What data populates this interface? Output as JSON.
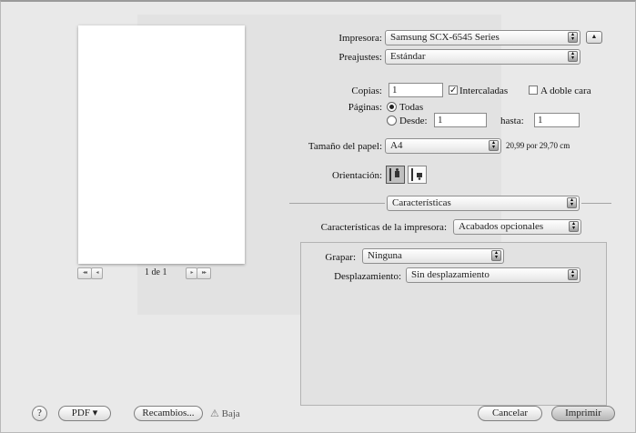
{
  "printer": {
    "label": "Impresora:",
    "value": "Samsung SCX-6545 Series"
  },
  "presets": {
    "label": "Preajustes:",
    "value": "Estándar"
  },
  "copies": {
    "label": "Copias:",
    "value": "1",
    "collate_label": "Intercaladas",
    "collate_checked": true,
    "duplex_label": "A doble cara",
    "duplex_checked": false
  },
  "pages": {
    "label": "Páginas:",
    "all_label": "Todas",
    "from_label": "Desde:",
    "from_value": "1",
    "to_label": "hasta:",
    "to_value": "1"
  },
  "paper_size": {
    "label": "Tamaño del papel:",
    "value": "A4",
    "dimensions": "20,99 por 29,70 cm"
  },
  "orientation": {
    "label": "Orientación:"
  },
  "section_popup": {
    "value": "Características"
  },
  "printer_features": {
    "label": "Características de la impresora:",
    "value": "Acabados opcionales"
  },
  "stapling": {
    "label": "Grapar:",
    "value": "Ninguna"
  },
  "offset": {
    "label": "Desplazamiento:",
    "value": "Sin desplazamiento"
  },
  "preview_nav": {
    "first": "◂◂",
    "prev": "◂",
    "page_text": "1 de 1",
    "next": "▸",
    "last": "▸▸"
  },
  "footer": {
    "help": "?",
    "pdf": "PDF ▾",
    "supplies": "Recambios...",
    "low_label": "Baja",
    "cancel": "Cancelar",
    "print": "Imprimir"
  }
}
